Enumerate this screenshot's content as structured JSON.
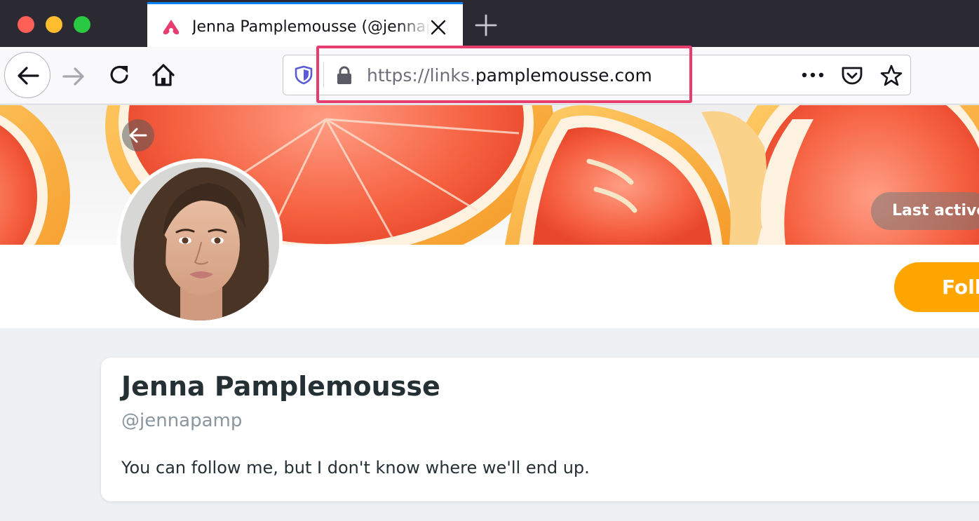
{
  "browser": {
    "tab": {
      "title": "Jenna Pamplemousse (@jennapamp)",
      "favicon": "pink-heart-link-icon"
    },
    "url": {
      "scheme_prefix": "https://links.",
      "domain": "pamplemousse.com"
    },
    "highlight_color": "#e63d6e"
  },
  "profile": {
    "last_active_label": "Last active",
    "follow_label": "Follow",
    "display_name": "Jenna Pamplemousse",
    "handle": "@jennapamp",
    "bio": "You can follow me, but I don't know where we'll end up.",
    "accent_color": "#ffa500"
  }
}
